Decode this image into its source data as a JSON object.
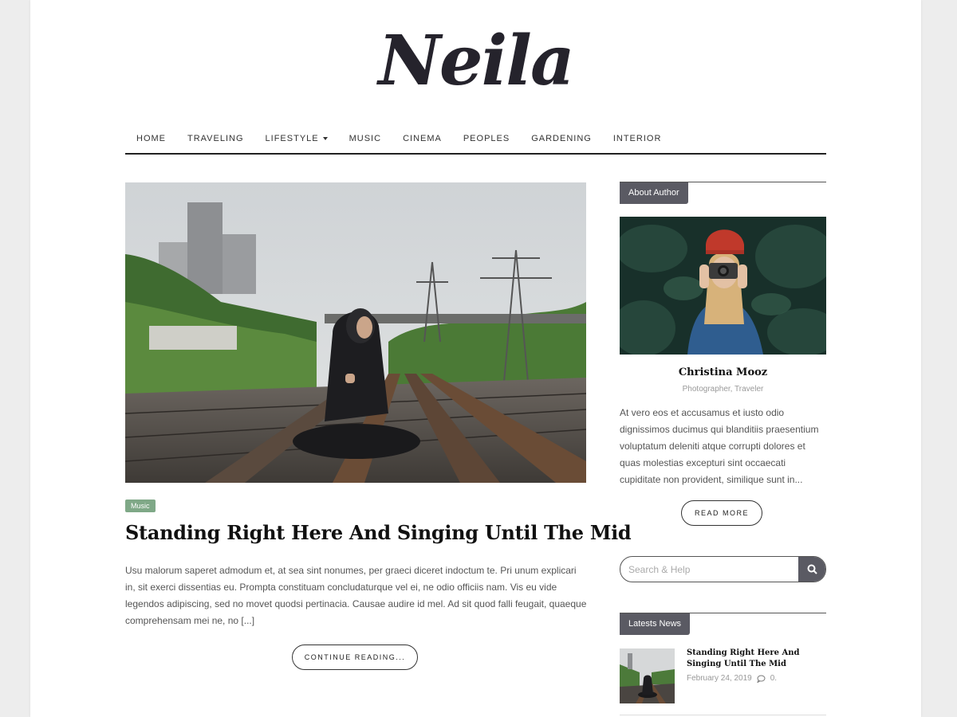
{
  "site": {
    "logo": "Neila"
  },
  "nav": {
    "items": [
      {
        "label": "HOME"
      },
      {
        "label": "TRAVELING"
      },
      {
        "label": "LIFESTYLE",
        "has_dropdown": true
      },
      {
        "label": "MUSIC"
      },
      {
        "label": "CINEMA"
      },
      {
        "label": "PEOPLES"
      },
      {
        "label": "GARDENING"
      },
      {
        "label": "INTERIOR"
      }
    ]
  },
  "post": {
    "category": "Music",
    "title": "Standing Right Here And Singing Until The Mid",
    "excerpt": "Usu malorum saperet admodum et, at sea sint nonumes, per graeci diceret indoctum te. Pri unum explicari in, sit exerci dissentias eu. Prompta constituam concludaturque vel ei, ne odio officiis nam. Vis eu vide legendos adipiscing, sed no movet quodsi pertinacia. Causae audire id mel. Ad sit quod falli feugait, quaeque comprehensam mei ne, no [...]",
    "continue_label": "CONTINUE READING..."
  },
  "sidebar": {
    "about": {
      "heading": "About Author",
      "name": "Christina Mooz",
      "role": "Photographer, Traveler",
      "bio": "At vero eos et accusamus et iusto odio dignissimos ducimus qui blanditiis praesentium voluptatum deleniti atque corrupti dolores et quas molestias excepturi sint occaecati cupiditate non provident, similique sunt in...",
      "read_more_label": "READ MORE"
    },
    "search": {
      "placeholder": "Search & Help"
    },
    "news": {
      "heading": "Latests News",
      "items": [
        {
          "title": "Standing Right Here And Singing Until The Mid",
          "date": "February 24, 2019",
          "comments": "0."
        }
      ]
    }
  },
  "colors": {
    "accent_dark": "#5a5a63",
    "tag_green": "#7fa887",
    "logo": "#25232c"
  },
  "icons": {
    "search": "search-icon",
    "comment": "comment-icon",
    "dropdown": "chevron-down-icon"
  }
}
